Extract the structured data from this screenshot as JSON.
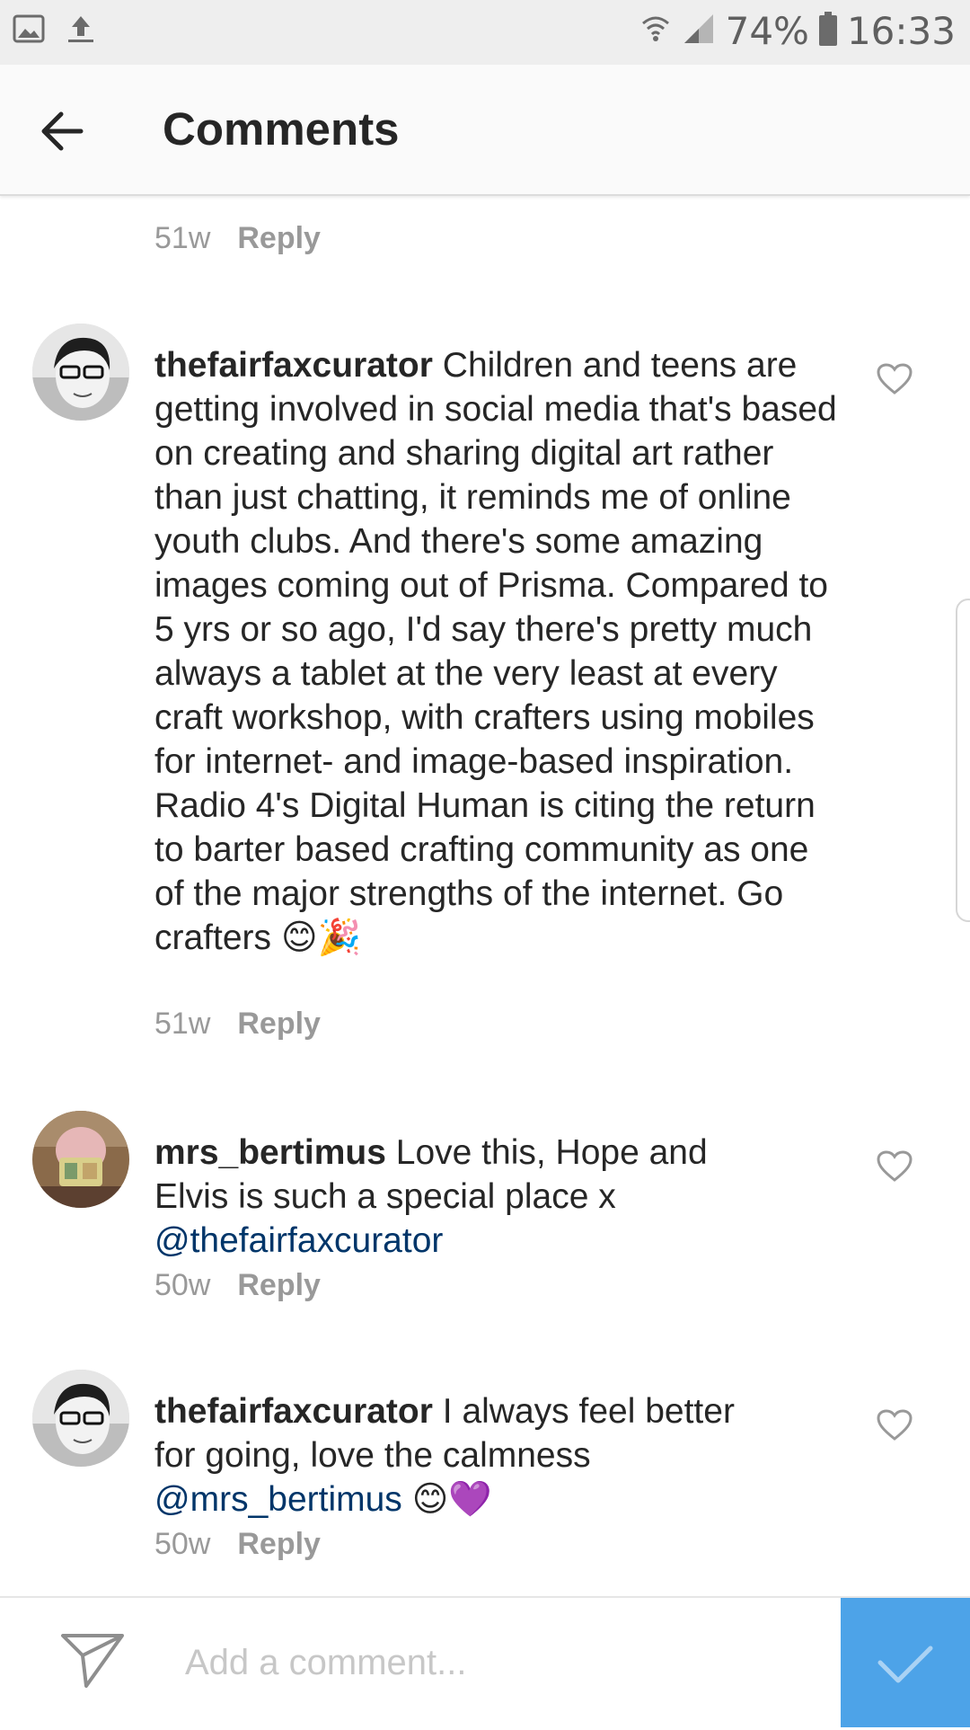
{
  "status_bar": {
    "battery": "74%",
    "time": "16:33",
    "icons": [
      "gallery-icon",
      "upload-icon",
      "wifi-icon",
      "signal-icon",
      "battery-icon"
    ]
  },
  "header": {
    "title": "Comments",
    "back_icon": "arrow-left-icon"
  },
  "comments": [
    {
      "partial": true,
      "age": "51w",
      "reply_label": "Reply"
    },
    {
      "username": "thefairfaxcurator",
      "text": "Children and teens are getting involved in social media that's based on creating and sharing digital art rather than just chatting, it reminds me of online youth clubs. And there's some amazing images coming out of Prisma. Compared to 5 yrs or so ago, I'd say there's pretty much always a tablet at the very least at every craft workshop, with crafters using mobiles for internet- and image-based inspiration. Radio 4's Digital Human is citing the return to barter based crafting community as one of the major strengths of the internet. Go crafters",
      "emojis": "😊🎉",
      "age": "51w",
      "reply_label": "Reply"
    },
    {
      "username": "mrs_bertimus",
      "text": "Love this, Hope and Elvis is such a special place x",
      "mention": "@thefairfaxcurator",
      "age": "50w",
      "reply_label": "Reply"
    },
    {
      "username": "thefairfaxcurator",
      "text": "I always feel better for going, love the calmness",
      "mention": "@mrs_bertimus",
      "emojis": "😊💜",
      "age": "50w",
      "reply_label": "Reply"
    }
  ],
  "composer": {
    "placeholder": "Add a comment...",
    "send_icon": "paper-plane-icon",
    "post_icon": "checkmark-icon",
    "post_color": "#4da3e8"
  },
  "colors": {
    "mention": "#003569",
    "meta": "#999999",
    "text": "#262626"
  }
}
